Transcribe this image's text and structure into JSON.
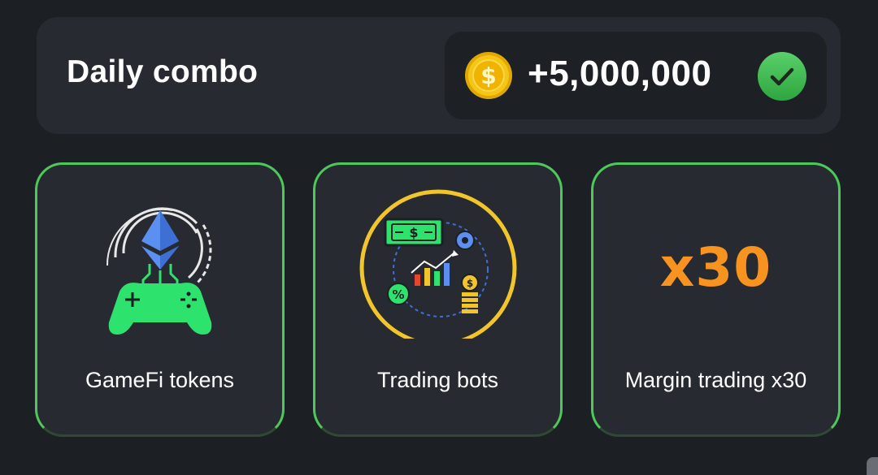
{
  "header": {
    "title": "Daily combo",
    "reward_amount": "+5,000,000",
    "coin_icon": "dollar-coin-icon",
    "status_icon": "check-circle-icon"
  },
  "cards": [
    {
      "label": "GameFi tokens",
      "icon": "ethereum-gamepad-icon"
    },
    {
      "label": "Trading bots",
      "icon": "trading-bot-chart-icon"
    },
    {
      "label": "Margin trading x30",
      "icon_text": "x30"
    }
  ],
  "colors": {
    "background": "#1c1f24",
    "card": "#272a30",
    "accent_green": "#4cc95a",
    "coin_gold": "#f5c518",
    "x30_orange": "#f7931e"
  }
}
